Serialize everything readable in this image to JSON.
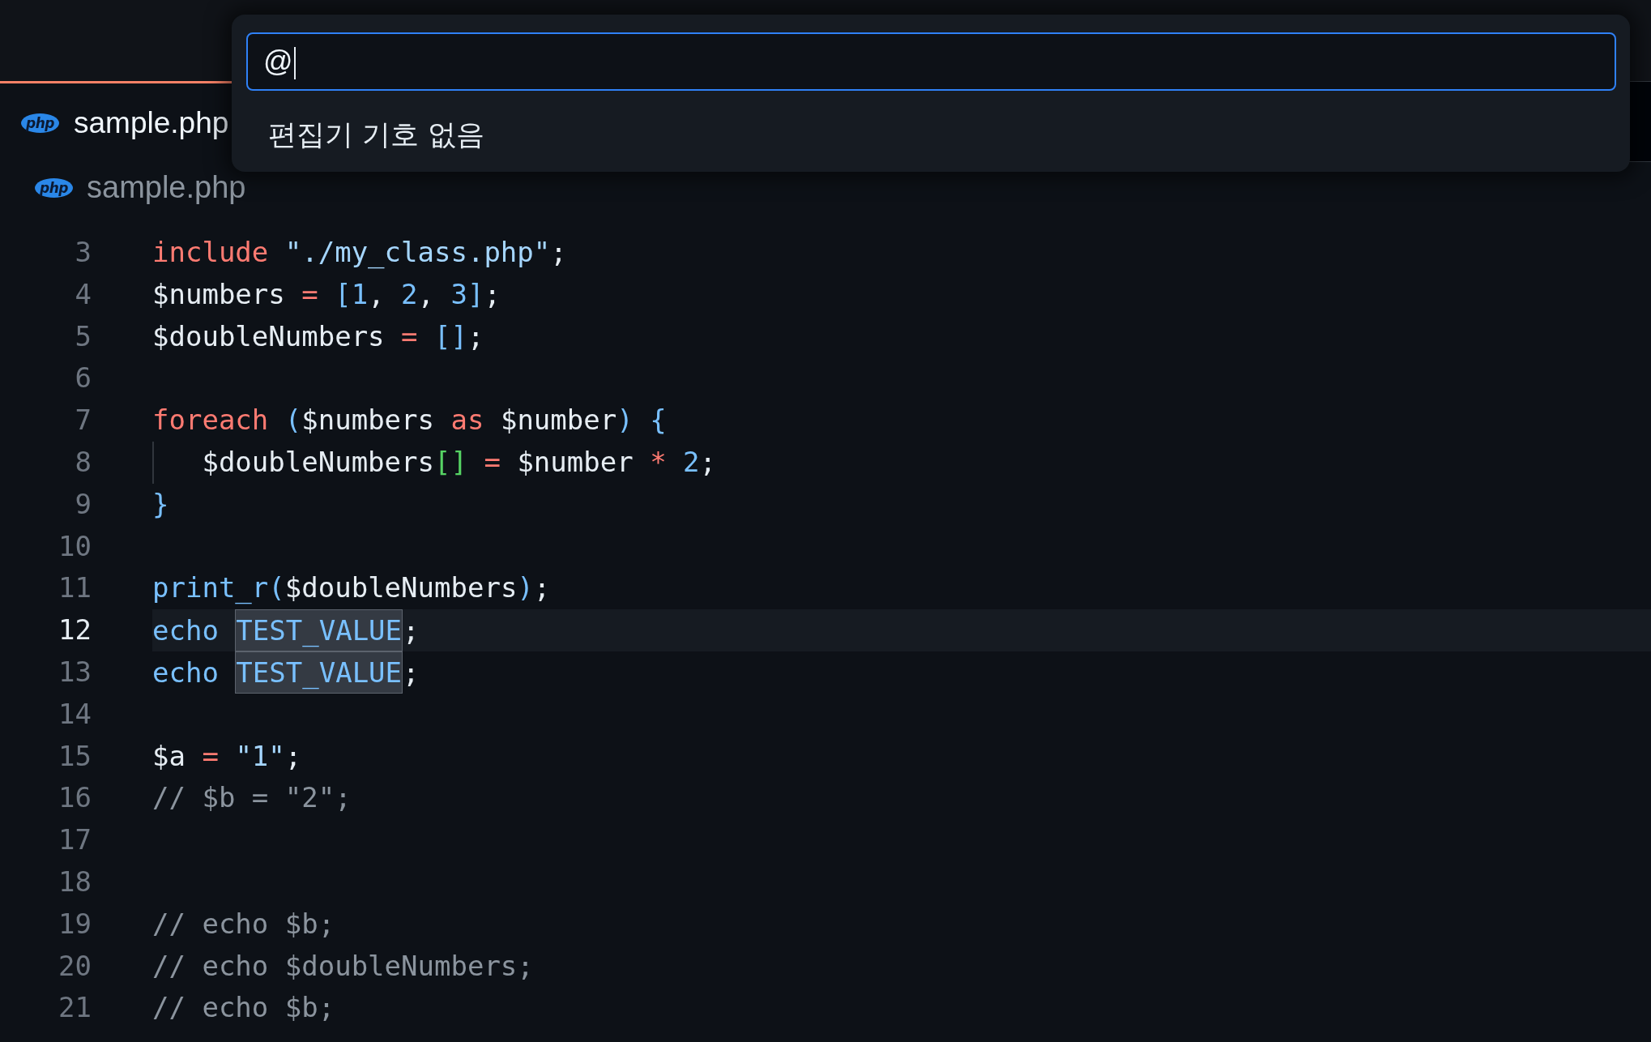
{
  "tabs": [
    {
      "label": "sample.php",
      "icon_label": "php",
      "selected": true
    }
  ],
  "breadcrumb": {
    "icon_label": "php",
    "label": "sample.php"
  },
  "editor": {
    "lines": [
      {
        "number": "3",
        "current": false,
        "tokens": [
          {
            "text": "include",
            "kind": "keyword",
            "highlighted": false
          },
          {
            "text": " \"./my_class.php\"",
            "kind": "string",
            "highlighted": false
          },
          {
            "text": ";",
            "kind": "plain",
            "highlighted": false
          }
        ]
      },
      {
        "number": "4",
        "current": false,
        "tokens": [
          {
            "text": "$numbers ",
            "kind": "plain",
            "highlighted": false
          },
          {
            "text": "=",
            "kind": "operator",
            "highlighted": false
          },
          {
            "text": " [",
            "kind": "bracket",
            "highlighted": false
          },
          {
            "text": "1",
            "kind": "number",
            "highlighted": false
          },
          {
            "text": ", ",
            "kind": "plain",
            "highlighted": false
          },
          {
            "text": "2",
            "kind": "number",
            "highlighted": false
          },
          {
            "text": ", ",
            "kind": "plain",
            "highlighted": false
          },
          {
            "text": "3",
            "kind": "number",
            "highlighted": false
          },
          {
            "text": "]",
            "kind": "bracket",
            "highlighted": false
          },
          {
            "text": ";",
            "kind": "plain",
            "highlighted": false
          }
        ]
      },
      {
        "number": "5",
        "current": false,
        "tokens": [
          {
            "text": "$doubleNumbers ",
            "kind": "plain",
            "highlighted": false
          },
          {
            "text": "=",
            "kind": "operator",
            "highlighted": false
          },
          {
            "text": " []",
            "kind": "bracket",
            "highlighted": false
          },
          {
            "text": ";",
            "kind": "plain",
            "highlighted": false
          }
        ]
      },
      {
        "number": "6",
        "current": false
      },
      {
        "number": "7",
        "current": false,
        "tokens": [
          {
            "text": "foreach",
            "kind": "keyword",
            "highlighted": false
          },
          {
            "text": " (",
            "kind": "bracket",
            "highlighted": false
          },
          {
            "text": "$numbers ",
            "kind": "plain",
            "highlighted": false
          },
          {
            "text": "as",
            "kind": "keyword",
            "highlighted": false
          },
          {
            "text": " $number",
            "kind": "plain",
            "highlighted": false
          },
          {
            "text": ")",
            "kind": "bracket",
            "highlighted": false
          },
          {
            "text": " {",
            "kind": "bracket",
            "highlighted": false
          }
        ]
      },
      {
        "number": "8",
        "current": false,
        "tokens": [
          {
            "text": "   $doubleNumbers",
            "kind": "plain",
            "highlighted": false
          },
          {
            "text": "[]",
            "kind": "nested_bracket",
            "highlighted": false
          },
          {
            "text": " =",
            "kind": "operator",
            "highlighted": false
          },
          {
            "text": " $number ",
            "kind": "plain",
            "highlighted": false
          },
          {
            "text": "*",
            "kind": "operator",
            "highlighted": false
          },
          {
            "text": " 2",
            "kind": "number",
            "highlighted": false
          },
          {
            "text": ";",
            "kind": "plain",
            "highlighted": false
          }
        ]
      },
      {
        "number": "9",
        "current": false,
        "tokens": [
          {
            "text": "}",
            "kind": "bracket",
            "highlighted": false
          }
        ]
      },
      {
        "number": "10",
        "current": false
      },
      {
        "number": "11",
        "current": false,
        "tokens": [
          {
            "text": "print_r",
            "kind": "function",
            "highlighted": false
          },
          {
            "text": "(",
            "kind": "bracket",
            "highlighted": false
          },
          {
            "text": "$doubleNumbers",
            "kind": "plain",
            "highlighted": false
          },
          {
            "text": ")",
            "kind": "bracket",
            "highlighted": false
          },
          {
            "text": ";",
            "kind": "plain",
            "highlighted": false
          }
        ]
      },
      {
        "number": "12",
        "current": true,
        "tokens": [
          {
            "text": "echo ",
            "kind": "function",
            "highlighted": false
          },
          {
            "text": "TEST_VALUE",
            "kind": "constant",
            "highlighted": true
          },
          {
            "text": ";",
            "kind": "plain",
            "highlighted": false
          }
        ]
      },
      {
        "number": "13",
        "current": false,
        "tokens": [
          {
            "text": "echo ",
            "kind": "function",
            "highlighted": false
          },
          {
            "text": "TEST_VALUE",
            "kind": "constant",
            "highlighted": true
          },
          {
            "text": ";",
            "kind": "plain",
            "highlighted": false
          }
        ]
      },
      {
        "number": "14",
        "current": false
      },
      {
        "number": "15",
        "current": false,
        "tokens": [
          {
            "text": "$a ",
            "kind": "plain",
            "highlighted": false
          },
          {
            "text": "=",
            "kind": "operator",
            "highlighted": false
          },
          {
            "text": " \"1\"",
            "kind": "string",
            "highlighted": false
          },
          {
            "text": ";",
            "kind": "plain",
            "highlighted": false
          }
        ]
      },
      {
        "number": "16",
        "current": false,
        "tokens": [
          {
            "text": "// $b = \"2\";",
            "kind": "comment",
            "highlighted": false
          }
        ]
      },
      {
        "number": "17",
        "current": false
      },
      {
        "number": "18",
        "current": false
      },
      {
        "number": "19",
        "current": false,
        "tokens": [
          {
            "text": "// echo $b;",
            "kind": "comment",
            "highlighted": false
          }
        ]
      },
      {
        "number": "20",
        "current": false,
        "tokens": [
          {
            "text": "// echo $doubleNumbers;",
            "kind": "comment",
            "highlighted": false
          }
        ]
      },
      {
        "number": "21",
        "current": false,
        "tokens": [
          {
            "text": "// echo $b;",
            "kind": "comment",
            "highlighted": false
          }
        ]
      }
    ]
  },
  "quick_open": {
    "input": {
      "value": "@",
      "focused": true
    },
    "message": "편집기 기호 없음"
  }
}
